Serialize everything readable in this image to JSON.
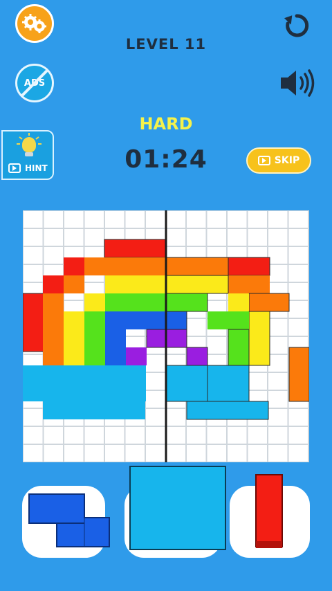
{
  "header": {
    "level_label": "LEVEL 11",
    "difficulty": "HARD",
    "timer": "01:24"
  },
  "buttons": {
    "settings_icon": "gear-icon",
    "ads_label": "ADS",
    "hint_label": "HINT",
    "skip_label": "SKIP",
    "undo_icon": "undo-icon",
    "sound_icon": "speaker-icon"
  },
  "colors": {
    "background": "#2f9bea",
    "red": "#f31e14",
    "orange": "#fb7a0a",
    "yellow": "#fbea1a",
    "green": "#55e21c",
    "blue": "#1a60e6",
    "purple": "#9a1ee0",
    "cyan": "#17b5ec",
    "skip": "#f7c21c",
    "settings": "#f7a21a"
  },
  "tray": {
    "pieces": [
      {
        "shape": "z-tetromino",
        "color": "blue"
      },
      {
        "shape": "square",
        "color": "cyan"
      },
      {
        "shape": "vertical-bar",
        "color": "red"
      }
    ]
  }
}
